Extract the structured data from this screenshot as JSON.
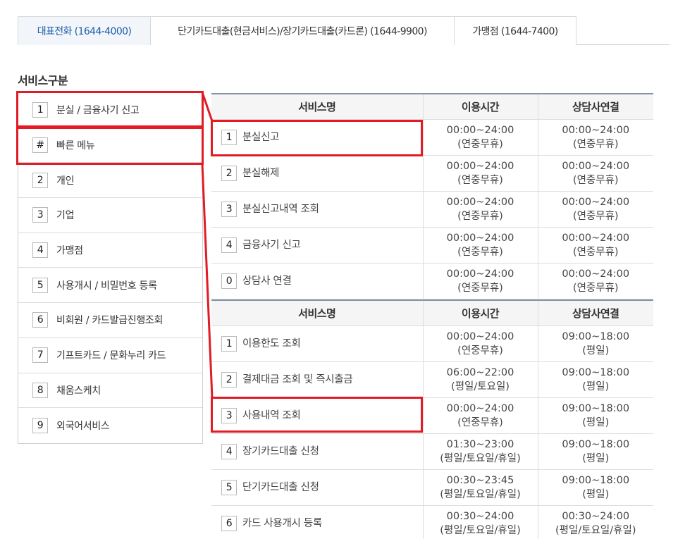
{
  "tabs": [
    {
      "label": "대표전화 (1644-4000)",
      "active": true
    },
    {
      "label": "단기카드대출(현금서비스)/장기카드대출(카드론) (1644-9900)",
      "active": false
    },
    {
      "label": "가맹점 (1644-7400)",
      "active": false
    }
  ],
  "section_title": "서비스구분",
  "menu": [
    {
      "num": "1",
      "label": "분실 / 금융사기 신고"
    },
    {
      "num": "#",
      "label": "빠른 메뉴"
    },
    {
      "num": "2",
      "label": "개인"
    },
    {
      "num": "3",
      "label": "기업"
    },
    {
      "num": "4",
      "label": "가맹점"
    },
    {
      "num": "5",
      "label": "사용개시 / 비밀번호 등록"
    },
    {
      "num": "6",
      "label": "비회원 / 카드발급진행조회"
    },
    {
      "num": "7",
      "label": "기프트카드 / 문화누리 카드"
    },
    {
      "num": "8",
      "label": "채움스케치"
    },
    {
      "num": "9",
      "label": "외국어서비스"
    }
  ],
  "table1": {
    "headers": [
      "서비스명",
      "이용시간",
      "상담사연결"
    ],
    "rows": [
      {
        "num": "1",
        "name": "분실신고",
        "time1": "00:00~24:00",
        "time2": "(연중무휴)",
        "agent1": "00:00~24:00",
        "agent2": "(연중무휴)"
      },
      {
        "num": "2",
        "name": "분실해제",
        "time1": "00:00~24:00",
        "time2": "(연중무휴)",
        "agent1": "00:00~24:00",
        "agent2": "(연중무휴)"
      },
      {
        "num": "3",
        "name": "분실신고내역 조회",
        "time1": "00:00~24:00",
        "time2": "(연중무휴)",
        "agent1": "00:00~24:00",
        "agent2": "(연중무휴)"
      },
      {
        "num": "4",
        "name": "금융사기 신고",
        "time1": "00:00~24:00",
        "time2": "(연중무휴)",
        "agent1": "00:00~24:00",
        "agent2": "(연중무휴)"
      },
      {
        "num": "0",
        "name": "상담사 연결",
        "time1": "00:00~24:00",
        "time2": "(연중무휴)",
        "agent1": "00:00~24:00",
        "agent2": "(연중무휴)"
      }
    ]
  },
  "table2": {
    "headers": [
      "서비스명",
      "이용시간",
      "상담사연결"
    ],
    "rows": [
      {
        "num": "1",
        "name": "이용한도 조회",
        "time1": "00:00~24:00",
        "time2": "(연중무휴)",
        "agent1": "09:00~18:00",
        "agent2": "(평일)"
      },
      {
        "num": "2",
        "name": "결제대금 조회 및 즉시출금",
        "time1": "06:00~22:00",
        "time2": "(평일/토요일)",
        "agent1": "09:00~18:00",
        "agent2": "(평일)"
      },
      {
        "num": "3",
        "name": "사용내역 조회",
        "time1": "00:00~24:00",
        "time2": "(연중무휴)",
        "agent1": "09:00~18:00",
        "agent2": "(평일)"
      },
      {
        "num": "4",
        "name": "장기카드대출 신청",
        "time1": "01:30~23:00",
        "time2": "(평일/토요일/휴일)",
        "agent1": "09:00~18:00",
        "agent2": "(평일)"
      },
      {
        "num": "5",
        "name": "단기카드대출 신청",
        "time1": "00:30~23:45",
        "time2": "(평일/토요일/휴일)",
        "agent1": "09:00~18:00",
        "agent2": "(평일)"
      },
      {
        "num": "6",
        "name": "카드 사용개시 등록",
        "time1": "00:30~24:00",
        "time2": "(평일/토요일/휴일)",
        "agent1": "00:30~24:00",
        "agent2": "(평일/토요일/휴일)"
      }
    ]
  },
  "colors": {
    "highlight": "#e21b24",
    "active_tab_text": "#1b5dab",
    "header_bg": "#f5f5f5",
    "table_top_border": "#8593a8"
  }
}
